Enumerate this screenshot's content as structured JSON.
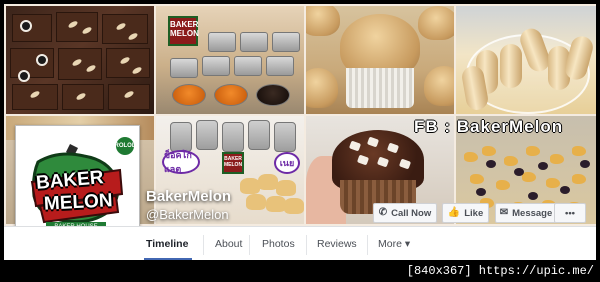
{
  "cover": {
    "watermark": "FB : BakerMelon",
    "tiles": [
      {
        "name": "brownies-photo"
      },
      {
        "name": "cups-photo"
      },
      {
        "name": "muffin-photo"
      },
      {
        "name": "cookie-rolls-photo"
      },
      {
        "name": "bakery-photo"
      },
      {
        "name": "cookies-jars-photo"
      },
      {
        "name": "chocolate-muffin-photo"
      },
      {
        "name": "snack-mix-photo"
      }
    ],
    "bubble_left": "ช็อคโกแลต",
    "bubble_right": "เนย"
  },
  "profile": {
    "logo_word_1": "BAKER",
    "logo_word_2": "MELON",
    "logo_badge": "ROLOL",
    "logo_banner": "BAKER HOUSE"
  },
  "page": {
    "name": "BakerMelon",
    "handle": "@BakerMelon"
  },
  "actions": {
    "call": "Call Now",
    "like": "Like",
    "message": "Message",
    "more": "•••"
  },
  "nav": {
    "timeline": "Timeline",
    "about": "About",
    "photos": "Photos",
    "reviews": "Reviews",
    "more": "More ▾"
  },
  "footer": {
    "text": "[840x367] https://upic.me/"
  },
  "colors": {
    "accent": "#4267b2",
    "text_dark": "#1d2129",
    "text_muted": "#4b4f56"
  },
  "icons": [
    "phone-icon",
    "thumbs-up-icon",
    "message-icon",
    "more-dots-icon"
  ]
}
